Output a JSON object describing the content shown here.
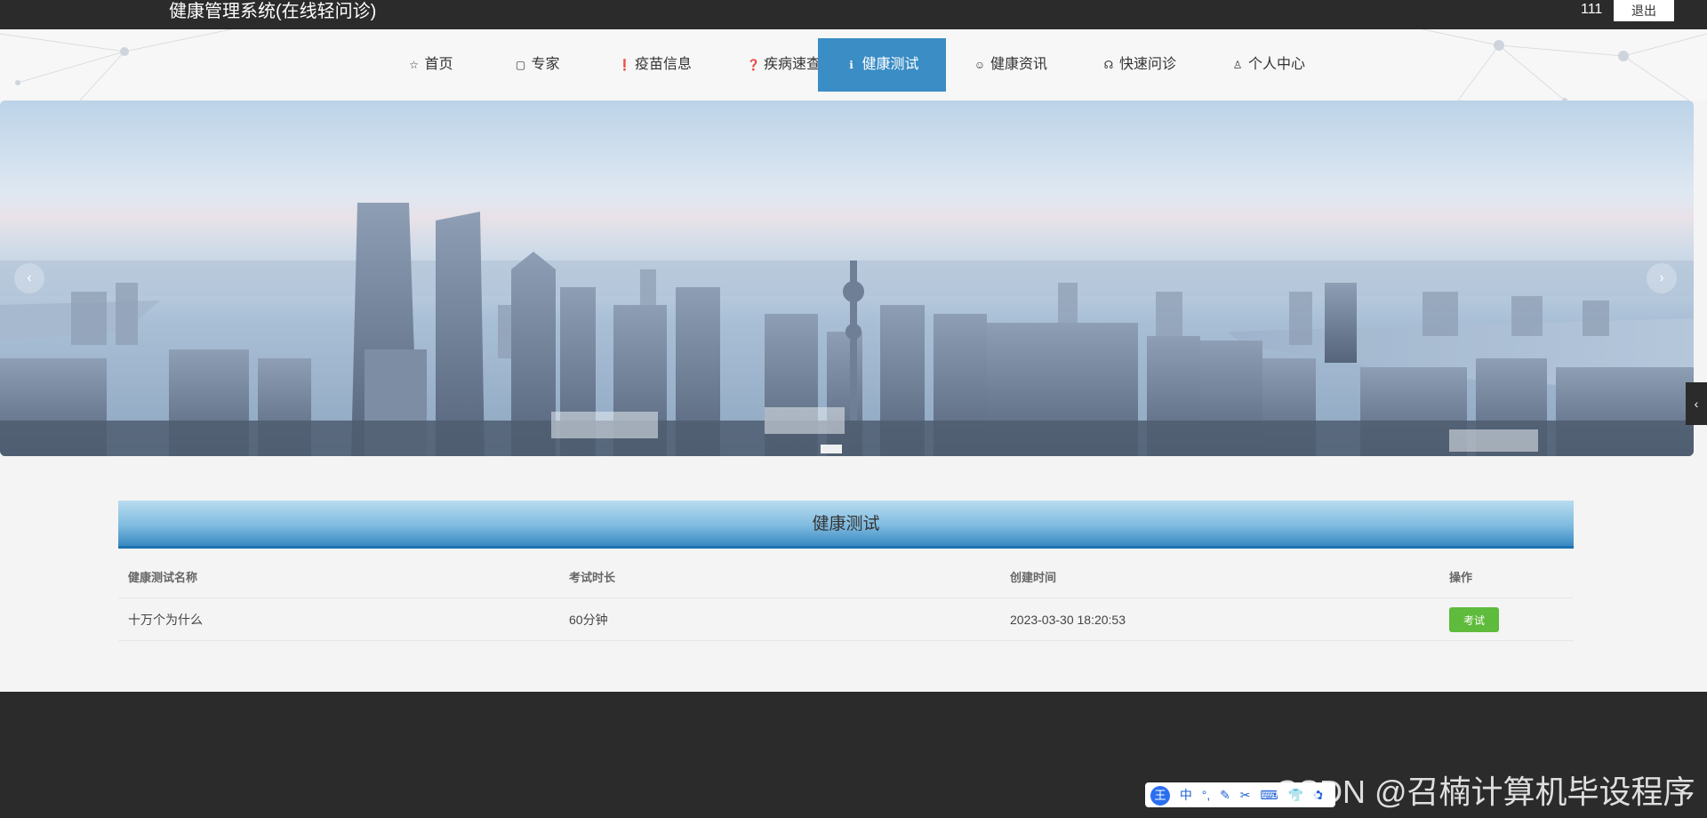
{
  "header": {
    "site_title": "健康管理系统(在线轻问诊)",
    "user": "111",
    "logout_label": "退出"
  },
  "nav": {
    "items": [
      {
        "icon": "star-outline-icon",
        "glyph": "☆",
        "label": "首页"
      },
      {
        "icon": "bag-icon",
        "glyph": "▢",
        "label": "专家"
      },
      {
        "icon": "exclamation-circle-icon",
        "glyph": "❗",
        "label": "疫苗信息"
      },
      {
        "icon": "question-circle-icon",
        "glyph": "❓",
        "label": "疾病速查"
      },
      {
        "icon": "info-circle-icon",
        "glyph": "ℹ",
        "label": "健康测试"
      },
      {
        "icon": "smiley-icon",
        "glyph": "☺",
        "label": "健康资讯"
      },
      {
        "icon": "headset-icon",
        "glyph": "☊",
        "label": "快速问诊"
      },
      {
        "icon": "user-icon",
        "glyph": "♙",
        "label": "个人中心"
      }
    ],
    "active_index": 4
  },
  "banner": {
    "prev_glyph": "‹",
    "next_glyph": "›",
    "side_glyph": "‹"
  },
  "section": {
    "title": "健康测试",
    "columns": [
      "健康测试名称",
      "考试时长",
      "创建时间",
      "操作"
    ],
    "rows": [
      {
        "name": "十万个为什么",
        "duration": "60分钟",
        "created": "2023-03-30 18:20:53",
        "action": "考试"
      }
    ]
  },
  "ime": {
    "logo": "王",
    "tools": [
      "中",
      "°,",
      "✎",
      "✂",
      "⌨",
      "👕",
      "✿"
    ]
  },
  "watermark": "CSDN @召楠计算机毕设程序",
  "colors": {
    "topbar": "#2b2b2b",
    "nav_active": "#3a8dc5",
    "section_header": "#3889c2",
    "exam_button": "#5fbb3c"
  }
}
